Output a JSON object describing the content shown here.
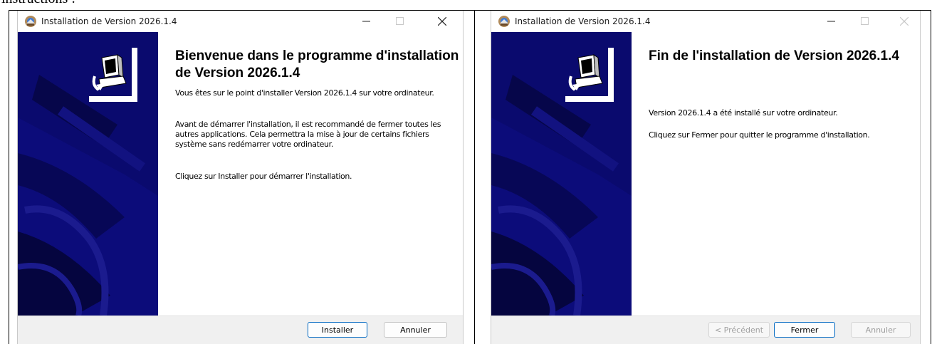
{
  "page_heading": "instructions :",
  "windows": [
    {
      "title": "Installation de Version 2026.1.4",
      "close_dimmed": false,
      "heading": "Bienvenue dans le programme d'installation de Version 2026.1.4",
      "paragraphs": [
        "Vous êtes sur le point d'installer Version 2026.1.4 sur votre ordinateur.",
        "Avant de démarrer l'installation, il est recommandé de fermer toutes les autres applications. Cela permettra la mise à jour de certains fichiers système sans redémarrer votre ordinateur.",
        "Cliquez sur Installer pour démarrer l'installation."
      ],
      "buttons": {
        "install": "Installer",
        "cancel": "Annuler"
      }
    },
    {
      "title": "Installation de Version 2026.1.4",
      "close_dimmed": true,
      "heading": "Fin de l'installation de Version 2026.1.4",
      "paragraphs": [
        "Version 2026.1.4 a été installé sur votre ordinateur.",
        "Cliquez sur Fermer pour quitter le programme d'installation."
      ],
      "buttons": {
        "back": "< Précédent",
        "close": "Fermer",
        "cancel": "Annuler"
      }
    }
  ],
  "icons": {
    "minimize": "minimize-icon",
    "maximize": "maximize-icon",
    "close": "close-icon",
    "app": "installer-app-icon",
    "logo": "computer-install-icon"
  },
  "colors": {
    "banner": "#0a0a6e",
    "default_button_border": "#0067c0",
    "footer": "#f0f0f0"
  }
}
